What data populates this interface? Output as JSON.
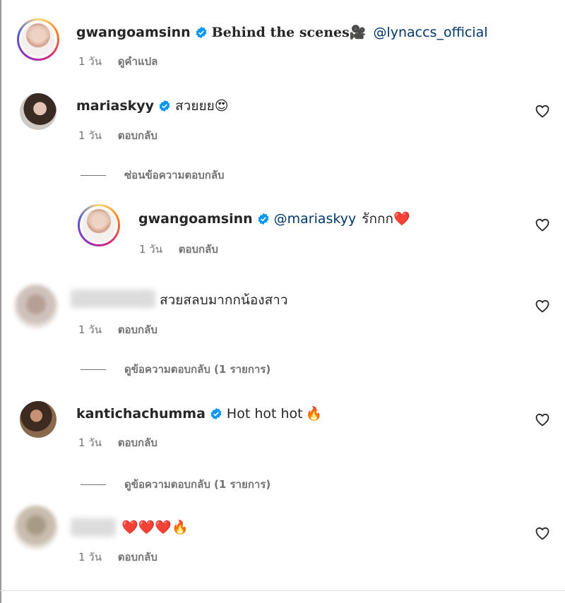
{
  "comments": [
    {
      "username": "gwangoamsinn",
      "verified": true,
      "text_bold": "Behind the scenes",
      "emoji": "🎥",
      "mention": "@lynaccs_official",
      "time": "1 วัน",
      "action": "ดูคำแปล"
    },
    {
      "username": "mariaskyy",
      "verified": true,
      "text": "สวยยย",
      "emoji": "😍",
      "time": "1 วัน",
      "action": "ตอบกลับ",
      "replies_toggle": "ซ่อนข้อความตอบกลับ",
      "reply": {
        "username": "gwangoamsinn",
        "verified": true,
        "mention": "@mariaskyy",
        "text": "รักกก",
        "emoji": "❤️",
        "time": "1 วัน",
        "action": "ตอบกลับ"
      }
    },
    {
      "username": "",
      "text": "สวยสลบมากกน้องสาว",
      "time": "1 วัน",
      "action": "ตอบกลับ",
      "replies_toggle": "ดูข้อความตอบกลับ (1 รายการ)"
    },
    {
      "username": "kantichachumma",
      "verified": true,
      "text": "Hot hot hot",
      "emoji": "🔥",
      "time": "1 วัน",
      "action": "ตอบกลับ",
      "replies_toggle": "ดูข้อความตอบกลับ (1 รายการ)"
    },
    {
      "username": "",
      "emoji": "❤️❤️❤️🔥",
      "time": "1 วัน",
      "action": "ตอบกลับ"
    }
  ],
  "icons": {
    "verified": "verified-badge-icon",
    "like": "heart-outline-icon"
  },
  "colors": {
    "verified": "#0095f6",
    "mention": "#00376b",
    "meta": "#737373"
  }
}
